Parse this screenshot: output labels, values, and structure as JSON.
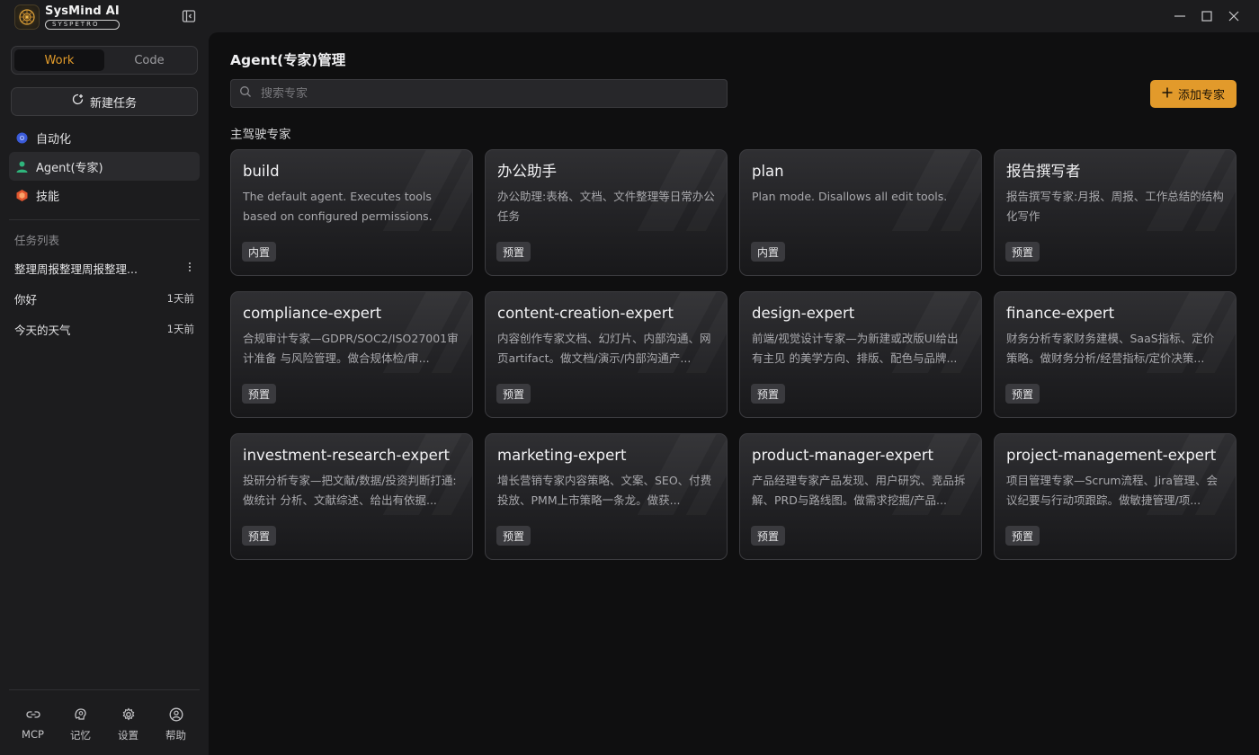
{
  "app": {
    "name": "SysMind AI",
    "sub": "SYSPETRO"
  },
  "colors": {
    "accent": "#e29a2b",
    "background": "#0f0f10",
    "sidebar": "#1c1c1e"
  },
  "mode_toggle": {
    "work": "Work",
    "code": "Code",
    "active": "Work"
  },
  "sidebar": {
    "new_task": "新建任务",
    "nav": [
      {
        "label": "自动化",
        "icon": "automation-icon"
      },
      {
        "label": "Agent(专家)",
        "icon": "agent-icon",
        "active": true
      },
      {
        "label": "技能",
        "icon": "skills-icon"
      }
    ],
    "tasks_label": "任务列表",
    "tasks": [
      {
        "title": "整理周报整理周报整理...",
        "time": ""
      },
      {
        "title": "你好",
        "time": "1天前"
      },
      {
        "title": "今天的天气",
        "time": "1天前"
      }
    ],
    "bottom": [
      {
        "label": "MCP",
        "icon": "link-icon"
      },
      {
        "label": "记忆",
        "icon": "memory-icon"
      },
      {
        "label": "设置",
        "icon": "gear-icon"
      },
      {
        "label": "帮助",
        "icon": "help-icon"
      }
    ]
  },
  "main": {
    "title": "Agent(专家)管理",
    "search_placeholder": "搜索专家",
    "add_button": "添加专家",
    "section_title": "主驾驶专家",
    "cards": [
      {
        "title": "build",
        "desc": "The default agent. Executes tools based on configured permissions.",
        "badge": "内置"
      },
      {
        "title": "办公助手",
        "desc": "办公助理:表格、文档、文件整理等日常办公任务",
        "badge": "预置"
      },
      {
        "title": "plan",
        "desc": "Plan mode. Disallows all edit tools.",
        "badge": "内置"
      },
      {
        "title": "报告撰写者",
        "desc": "报告撰写专家:月报、周报、工作总结的结构化写作",
        "badge": "预置"
      },
      {
        "title": "compliance-expert",
        "desc": "合规审计专家—GDPR/SOC2/ISO27001审计准备 与风险管理。做合规体检/审...",
        "badge": "预置"
      },
      {
        "title": "content-creation-expert",
        "desc": "内容创作专家文档、幻灯片、内部沟通、网页artifact。做文档/演示/内部沟通产...",
        "badge": "预置"
      },
      {
        "title": "design-expert",
        "desc": "前端/视觉设计专家—为新建或改版UI给出有主见 的美学方向、排版、配色与品牌...",
        "badge": "预置"
      },
      {
        "title": "finance-expert",
        "desc": "财务分析专家财务建模、SaaS指标、定价策略。做财务分析/经营指标/定价决策...",
        "badge": "预置"
      },
      {
        "title": "investment-research-expert",
        "desc": "投研分析专家—把文献/数据/投资判断打通:做统计 分析、文献综述、给出有依据...",
        "badge": "预置"
      },
      {
        "title": "marketing-expert",
        "desc": "增长营销专家内容策略、文案、SEO、付费投放、PMM上市策略一条龙。做获...",
        "badge": "预置"
      },
      {
        "title": "product-manager-expert",
        "desc": "产品经理专家产品发现、用户研究、竞品拆解、PRD与路线图。做需求挖掘/产品...",
        "badge": "预置"
      },
      {
        "title": "project-management-expert",
        "desc": "项目管理专家—Scrum流程、Jira管理、会议纪要与行动项跟踪。做敏捷管理/项...",
        "badge": "预置"
      }
    ]
  }
}
